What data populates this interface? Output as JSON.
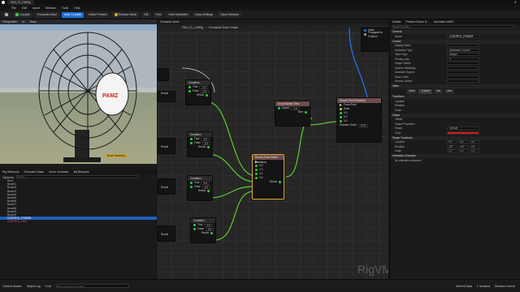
{
  "titlebar": {
    "tab": "FAN_01_CtrlRig"
  },
  "menu": [
    "File",
    "Edit",
    "Asset",
    "Window",
    "Tools",
    "Help"
  ],
  "toolbar": {
    "save": "",
    "compile": "Compile",
    "find_asset": "",
    "forwards_solve": "Forwards Solve",
    "auto_compile": "Auto Compile",
    "editor_preview": "Editor Preview",
    "release_mode": "Release Mode",
    "diff": "Diff",
    "find": "Find",
    "hide_unrelated": "Hide Unrelated",
    "class_settings": "Class Settings",
    "class_defaults": "Class Defaults"
  },
  "viewport": {
    "tabs": [
      "Perspective",
      "Lit",
      "Show"
    ],
    "fan_logo": "PAMZ",
    "overlay_note": "Bone Hierarchy"
  },
  "hierarchy": {
    "tabs": [
      "Rig Hierarchy",
      "Execution Stack",
      "Curve Container",
      "My Blueprint"
    ],
    "search_placeholder": "Search...",
    "options_label": "Options",
    "items": [
      {
        "label": "Root",
        "selected": false,
        "red": false
      },
      {
        "label": "Bone01",
        "selected": false,
        "red": false
      },
      {
        "label": "Bone02",
        "selected": false,
        "red": false
      },
      {
        "label": "Bone03",
        "selected": false,
        "red": false
      },
      {
        "label": "Bone04",
        "selected": false,
        "red": false
      },
      {
        "label": "Bone05",
        "selected": false,
        "red": false
      },
      {
        "label": "Bone06",
        "selected": false,
        "red": false
      },
      {
        "label": "Bone07",
        "selected": false,
        "red": false
      },
      {
        "label": "Bone08",
        "selected": false,
        "red": false
      },
      {
        "label": "Bone09",
        "selected": false,
        "red": false
      },
      {
        "label": "Bone10",
        "selected": false,
        "red": false
      },
      {
        "label": "CONTROL_POWER",
        "selected": true,
        "red": false
      },
      {
        "label": "CONTROL_FAN",
        "selected": false,
        "red": true
      }
    ]
  },
  "graph": {
    "tabs": [
      "Forwards Solve"
    ],
    "breadcrumb_root": "FAN_01_CtrlRig",
    "breadcrumb_leaf": "Forwards Solve Graph",
    "watermark": "RigVM",
    "top_node": {
      "value": "Value",
      "propagate": "Propagate to Children"
    },
    "nodes": {
      "condition": "Condition",
      "true": "True",
      "false": "False",
      "result": "Result",
      "select": "Result (Float Ifnelle, precision)",
      "accumulated": "Accumulated Time",
      "speed": "Speed",
      "time": "Time",
      "from_euler": "From Euler",
      "rotation_order": "Rotation Order",
      "result_euler": "Result (From Rotation)",
      "euler": "Euler",
      "xyz": "XYZ",
      "val1": "1.0",
      "val0": "0.0",
      "val2": "2.0",
      "val05": "0.5"
    }
  },
  "details": {
    "tabs": [
      "Details",
      "Preview Scene S...",
      "Animation MKR..."
    ],
    "search_placeholder": "Search Details",
    "general": "General",
    "name_label": "Name",
    "name_value": "CONTROL_POWER",
    "control_section": "Control",
    "props": [
      "Display Name",
      "Animation Type",
      "Value Type",
      "Primary Axis",
      "Shape Visible",
      "Modern Switching",
      "Available Spaces",
      "Draw Limits",
      "Access Limited"
    ],
    "anim_type": "Animation Control",
    "value_type": "Integer",
    "primary_axis": "X",
    "initial_section": "Value",
    "value_tabs": [
      "Initial",
      "Current",
      "Min",
      "Max"
    ],
    "transform": "Transform",
    "rows": [
      "Location",
      "Rotation",
      "Scale"
    ],
    "shape": "Shape",
    "shape_props": [
      "Visible",
      "Shape Properties",
      "Shape",
      "Color"
    ],
    "shape_value": "Default",
    "shape_transform": "Shape Transform",
    "loc_vals": [
      "0.0",
      "0.0",
      "0.0"
    ],
    "rot_vals": [
      "-90°",
      "-90°",
      "0.0"
    ],
    "scale_vals": [
      "1.0",
      "1.0",
      "1.0"
    ],
    "animation_channels": "Animation Channels",
    "no_channels": "No animation channels"
  },
  "statusbar": {
    "content_drawer": "Content Drawer",
    "output_log": "Output Log",
    "cmd": "Cmd",
    "cmd_placeholder": "Enter Console Command",
    "derived": "Derived Data",
    "unsaved": "1 Unsaved",
    "revision": "Revision Control"
  },
  "colors": {
    "accent": "#1f6fd6",
    "wire": "#5ccc2e",
    "exec": "#dddddd",
    "shape_color": "#d01a1a"
  }
}
